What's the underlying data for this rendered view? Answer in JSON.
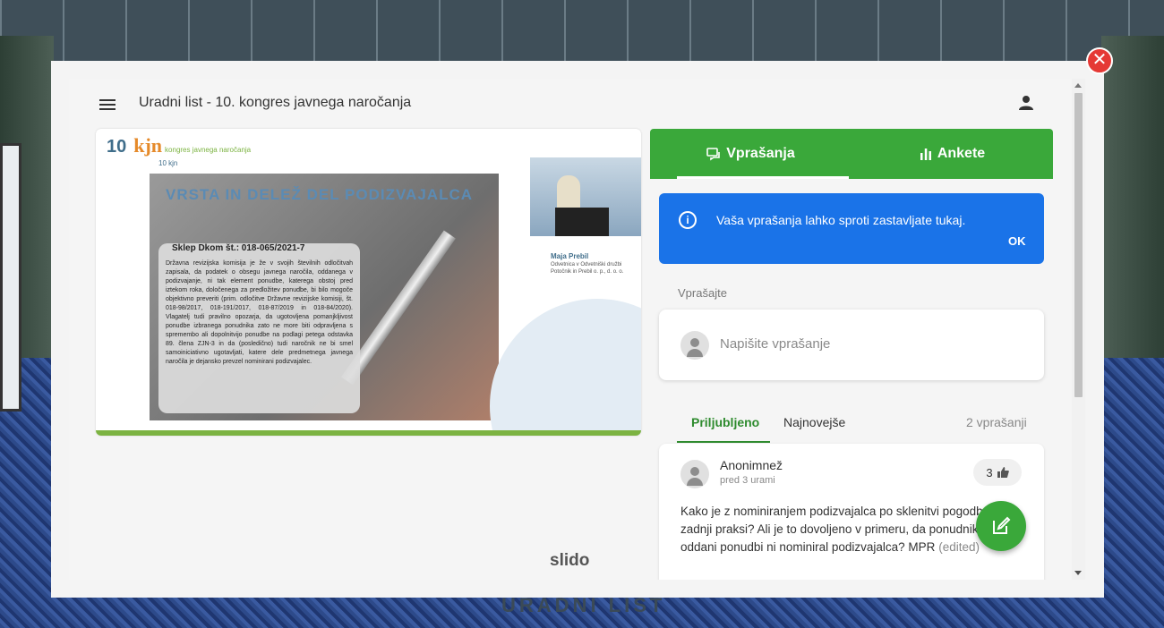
{
  "close": {
    "glyph": "✕"
  },
  "header": {
    "title": "Uradni list - 10. kongres javnega naročanja"
  },
  "slide": {
    "logo_number": "10",
    "logo_brand": "kjn",
    "logo_caption": "kongres javnega naročanja",
    "topline": "10 kjn",
    "heading": "VRSTA IN DELEŽ DEL PODIZVAJALCA",
    "note_title": "Sklep Dkom št.: 018-065/2021-7",
    "note_body": "Državna revizijska komisija je že v svojih številnih odločitvah zapisala, da podatek o obsegu javnega naročila, oddanega v podizvajanje, ni tak element ponudbe, katerega obstoj pred iztekom roka, določenega za predložitev ponudbe, bi bilo mogoče objektivno preveriti (prim. odločitve Državne revizijske komisiji, št. 018-98/2017, 018-191/2017, 018-87/2019 in 018-84/2020). Vlagatelj tudi pravilno opozarja, da ugotovljena pomanjkljivost ponudbe izbranega ponudnika zato ne more biti odpravljena s spremembo ali dopolnitvijo ponudbe na podlagi petega odstavka 89. člena ZJN-3 in da (posledično) tudi naročnik ne bi smel samoiniciativno ugotavljati, katere dele predmetnega javnega naročila je dejansko prevzel nominirani podizvajalec.",
    "speaker_name": "Maja Prebil",
    "speaker_role": "Odvetnica v Odvetniški družbi Potočnik in Prebil o. p., d. o. o."
  },
  "brand": "slido",
  "tabs": [
    {
      "label": "Vprašanja",
      "icon": "chat-icon"
    },
    {
      "label": "Ankete",
      "icon": "bar-chart-icon"
    }
  ],
  "info": {
    "icon": "i",
    "text": "Vaša vprašanja lahko sproti zastavljate tukaj.",
    "ok": "OK"
  },
  "ask": {
    "label": "Vprašajte",
    "placeholder": "Napišite vprašanje"
  },
  "sort": {
    "liked": "Priljubljeno",
    "newest": "Najnovejše",
    "count": "2 vprašanji"
  },
  "questions": [
    {
      "author": "Anonimnež",
      "time": "pred 3 urami",
      "likes": "3",
      "text": "Kako je z nominiranjem podizvajalca po sklenitvi pogodbe po zadnji praksi? Ali je to dovoljeno v primeru, da ponudnik v svoji oddani ponudbi ni nominiral podizvajalca? MPR",
      "edited": "(edited)"
    }
  ],
  "background": {
    "banner": "URADNI LIST"
  },
  "colors": {
    "green": "#3aa83a",
    "blue": "#1a73e8",
    "close": "#e53935"
  }
}
